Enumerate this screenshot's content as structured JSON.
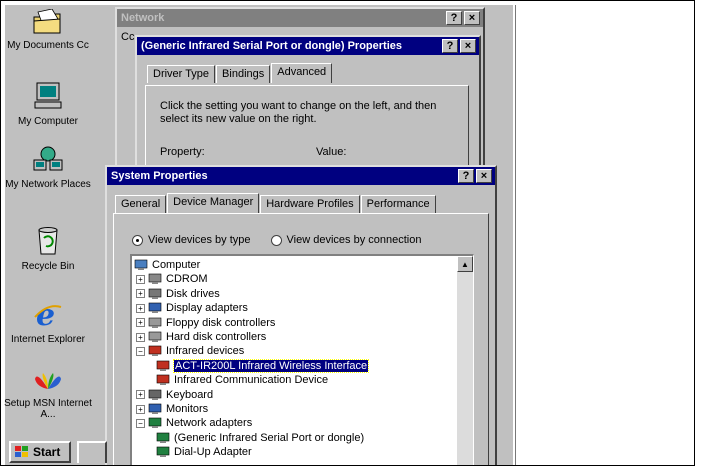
{
  "desktop": {
    "icons": [
      {
        "label": "My Documents Cc",
        "icon": "folder-icon"
      },
      {
        "label": "My Computer",
        "icon": "computer-icon"
      },
      {
        "label": "My Network Places",
        "icon": "network-places-icon"
      },
      {
        "label": "Recycle Bin",
        "icon": "recycle-bin-icon"
      },
      {
        "label": "Internet Explorer",
        "icon": "internet-explorer-icon"
      },
      {
        "label": "Setup MSN Internet A...",
        "icon": "msn-butterfly-icon"
      }
    ]
  },
  "network_window": {
    "title": "Network",
    "tab_stub": "Cc",
    "help_btn": "?",
    "close_btn": "×"
  },
  "ir_window": {
    "title": "(Generic Infrared Serial Port or dongle) Properties",
    "help_btn": "?",
    "close_btn": "×",
    "tabs": [
      "Driver Type",
      "Bindings",
      "Advanced"
    ],
    "selected_tab": "Advanced",
    "instruction": "Click the setting you want to change on the left, and then select its new value on the right.",
    "property_label": "Property:",
    "value_label": "Value:"
  },
  "sys_window": {
    "title": "System Properties",
    "help_btn": "?",
    "close_btn": "×",
    "tabs": [
      "General",
      "Device Manager",
      "Hardware Profiles",
      "Performance"
    ],
    "selected_tab": "Device Manager",
    "view_by_type": "View devices by type",
    "view_by_connection": "View devices by connection",
    "view_selected": "type",
    "tree": [
      {
        "label": "Computer",
        "icon": "computer-icon",
        "level": 0,
        "expander": ""
      },
      {
        "label": "CDROM",
        "icon": "cdrom-icon",
        "level": 1,
        "expander": "+"
      },
      {
        "label": "Disk drives",
        "icon": "disk-drive-icon",
        "level": 1,
        "expander": "+"
      },
      {
        "label": "Display adapters",
        "icon": "display-adapter-icon",
        "level": 1,
        "expander": "+"
      },
      {
        "label": "Floppy disk controllers",
        "icon": "floppy-controller-icon",
        "level": 1,
        "expander": "+"
      },
      {
        "label": "Hard disk controllers",
        "icon": "hard-disk-controller-icon",
        "level": 1,
        "expander": "+"
      },
      {
        "label": "Infrared devices",
        "icon": "infrared-icon",
        "level": 1,
        "expander": "−"
      },
      {
        "label": "ACT-IR200L Infrared Wireless Interface",
        "icon": "infrared-icon",
        "level": 2,
        "expander": "",
        "selected": true
      },
      {
        "label": "Infrared Communication Device",
        "icon": "infrared-icon",
        "level": 2,
        "expander": ""
      },
      {
        "label": "Keyboard",
        "icon": "keyboard-icon",
        "level": 1,
        "expander": "+"
      },
      {
        "label": "Monitors",
        "icon": "monitor-icon",
        "level": 1,
        "expander": "+"
      },
      {
        "label": "Network adapters",
        "icon": "network-adapter-icon",
        "level": 1,
        "expander": "−"
      },
      {
        "label": "(Generic Infrared Serial Port or dongle)",
        "icon": "network-adapter-icon",
        "level": 2,
        "expander": ""
      },
      {
        "label": "Dial-Up Adapter",
        "icon": "network-adapter-icon",
        "level": 2,
        "expander": ""
      }
    ]
  },
  "taskbar": {
    "start_label": "Start"
  }
}
